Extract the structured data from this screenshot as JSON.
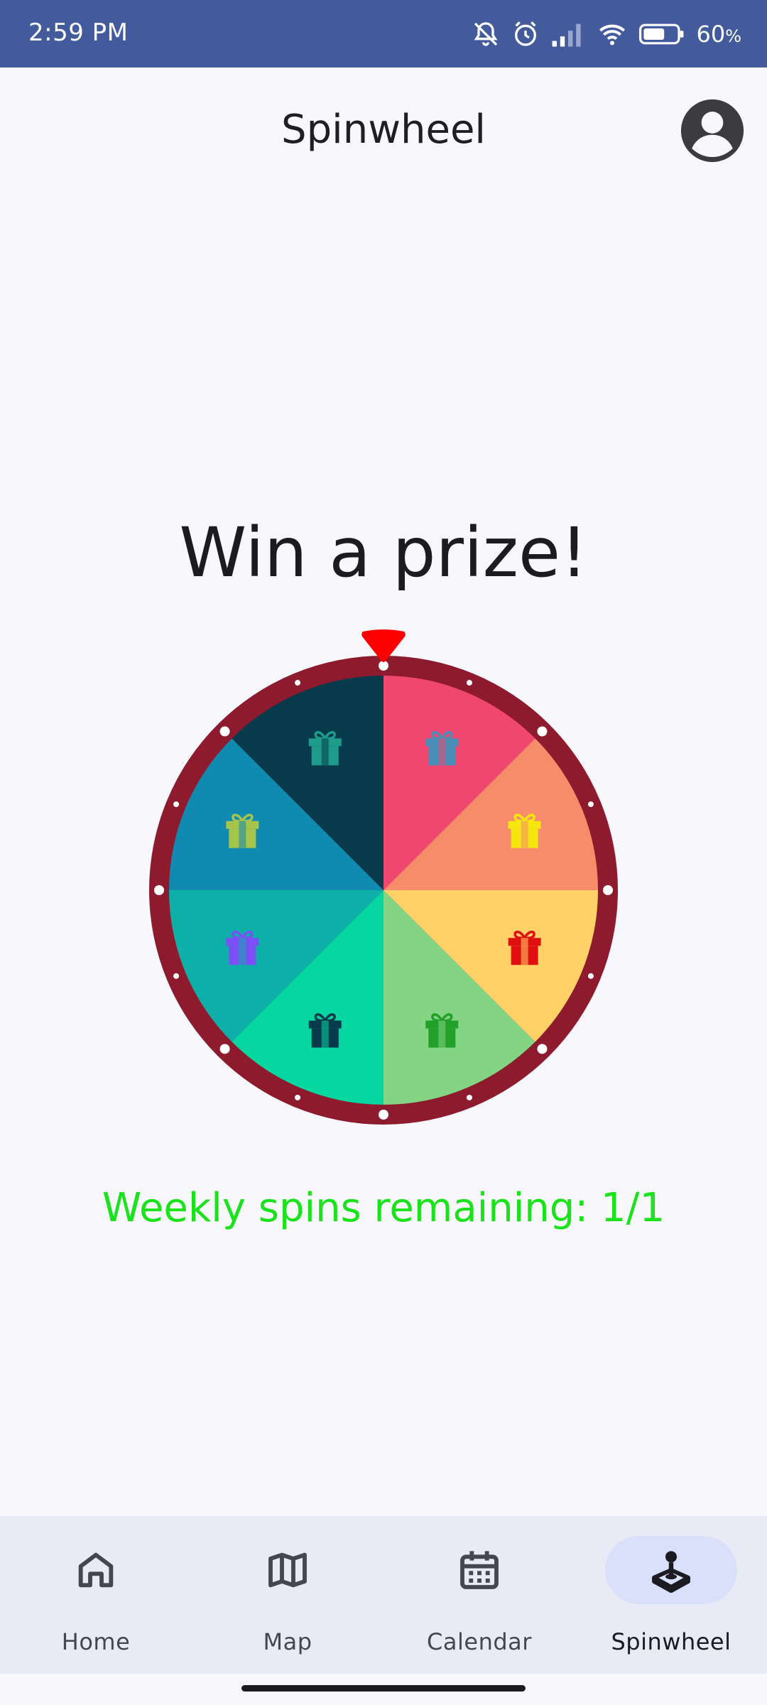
{
  "status_bar": {
    "time": "2:59 PM",
    "battery_value": "60",
    "battery_unit": "%",
    "background": "#435b9c",
    "icons": [
      "bell-off-icon",
      "alarm-icon",
      "signal-icon",
      "wifi-icon",
      "battery-icon"
    ]
  },
  "app_bar": {
    "title": "Spinwheel",
    "profile_icon": "account-circle-icon"
  },
  "main": {
    "headline": "Win a prize!",
    "spins_text": "Weekly spins remaining: 1/1",
    "spins_color": "#1be31b"
  },
  "wheel": {
    "rim_color": "#8e1a2e",
    "pointer_color": "#ff0000",
    "segments": [
      {
        "color": "#ef476f",
        "gift_color": "#4a8fb8"
      },
      {
        "color": "#f78c6b",
        "gift_color": "#f5e60f"
      },
      {
        "color": "#ffd166",
        "gift_color": "#e01010"
      },
      {
        "color": "#83d483",
        "gift_color": "#22a02a"
      },
      {
        "color": "#06d6a0",
        "gift_color": "#073b4c"
      },
      {
        "color": "#0cb0a9",
        "gift_color": "#7b4ff5"
      },
      {
        "color": "#118ab2",
        "gift_color": "#a6c44a"
      },
      {
        "color": "#073b4c",
        "gift_color": "#1e9b8a"
      }
    ]
  },
  "bottom_nav": {
    "items": [
      {
        "label": "Home",
        "icon": "home-icon"
      },
      {
        "label": "Map",
        "icon": "map-icon"
      },
      {
        "label": "Calendar",
        "icon": "calendar-icon"
      },
      {
        "label": "Spinwheel",
        "icon": "joystick-icon"
      }
    ],
    "active": "Spinwheel"
  }
}
